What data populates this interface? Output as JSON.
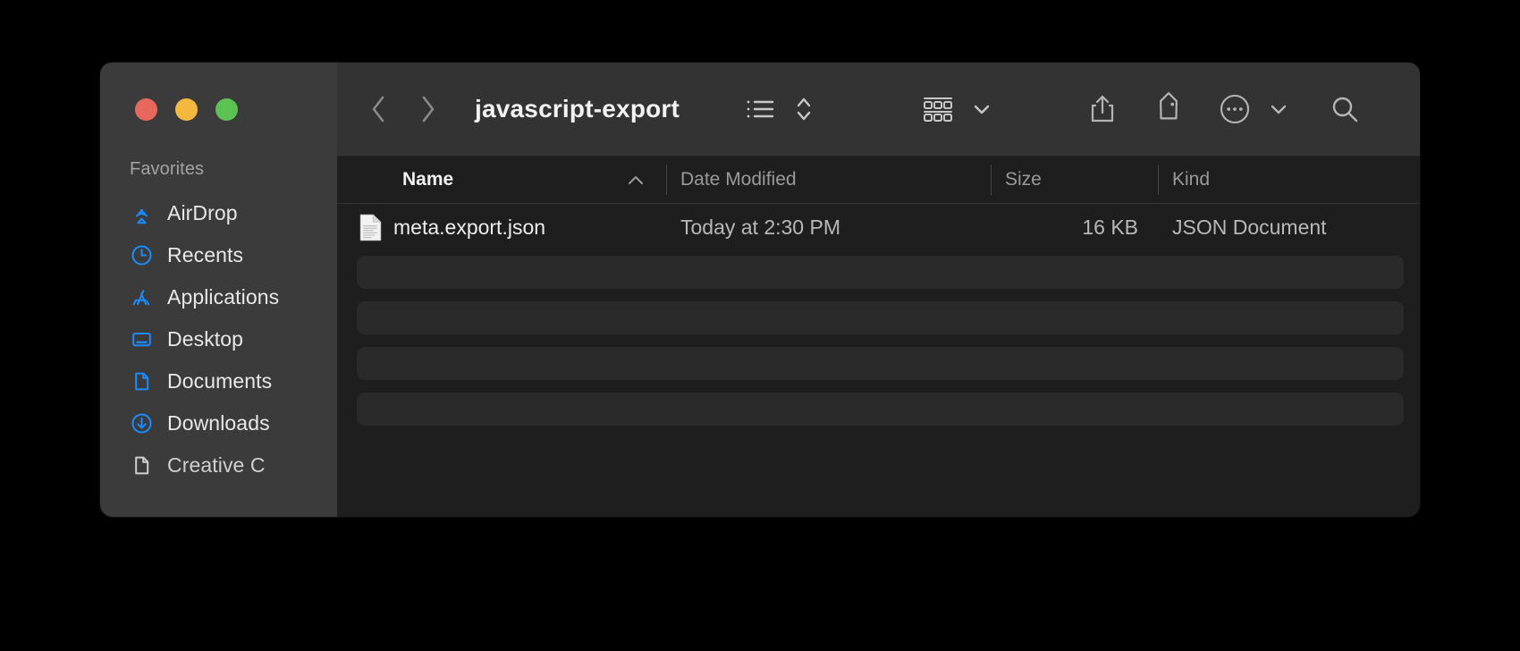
{
  "window": {
    "title": "javascript-export",
    "traffic_lights": [
      {
        "name": "close",
        "color": "#e8685e"
      },
      {
        "name": "minimize",
        "color": "#f2b840"
      },
      {
        "name": "maximize",
        "color": "#5cc352"
      }
    ],
    "background": "#1e1e1e",
    "sidebar_background": "#3b3b3b",
    "toolbar_background": "#333333",
    "accent": "#1a8cff"
  },
  "toolbar": {
    "back_icon": "chevron-left-icon",
    "forward_icon": "chevron-right-icon",
    "view_list_icon": "list-view-icon",
    "sort_order_icon": "chevron-up-down-icon",
    "group_icon": "group-view-icon",
    "group_chevron_icon": "chevron-down-icon",
    "share_icon": "share-icon",
    "tag_icon": "tag-icon",
    "more_icon": "more-actions-icon",
    "more_chevron_icon": "chevron-down-icon",
    "search_icon": "search-icon"
  },
  "sidebar": {
    "section_title": "Favorites",
    "items": [
      {
        "label": "AirDrop",
        "icon": "airdrop-icon"
      },
      {
        "label": "Recents",
        "icon": "clock-icon"
      },
      {
        "label": "Applications",
        "icon": "applications-icon"
      },
      {
        "label": "Desktop",
        "icon": "desktop-icon"
      },
      {
        "label": "Documents",
        "icon": "document-icon"
      },
      {
        "label": "Downloads",
        "icon": "download-icon"
      },
      {
        "label": "Creative C",
        "icon": "folder-document-icon"
      }
    ]
  },
  "file_browser": {
    "columns": [
      {
        "key": "name",
        "label": "Name",
        "sorted": true,
        "sort_direction": "ascending"
      },
      {
        "key": "date",
        "label": "Date Modified",
        "sorted": false,
        "sort_direction": ""
      },
      {
        "key": "size",
        "label": "Size",
        "sorted": false,
        "sort_direction": ""
      },
      {
        "key": "kind",
        "label": "Kind",
        "sorted": false,
        "sort_direction": ""
      }
    ],
    "rows": [
      {
        "icon": "json-file-icon",
        "name": "meta.export.json",
        "date": "Today at 2:30 PM",
        "size": "16 KB",
        "kind": "JSON Document"
      }
    ],
    "placeholder_row_count": 4
  }
}
